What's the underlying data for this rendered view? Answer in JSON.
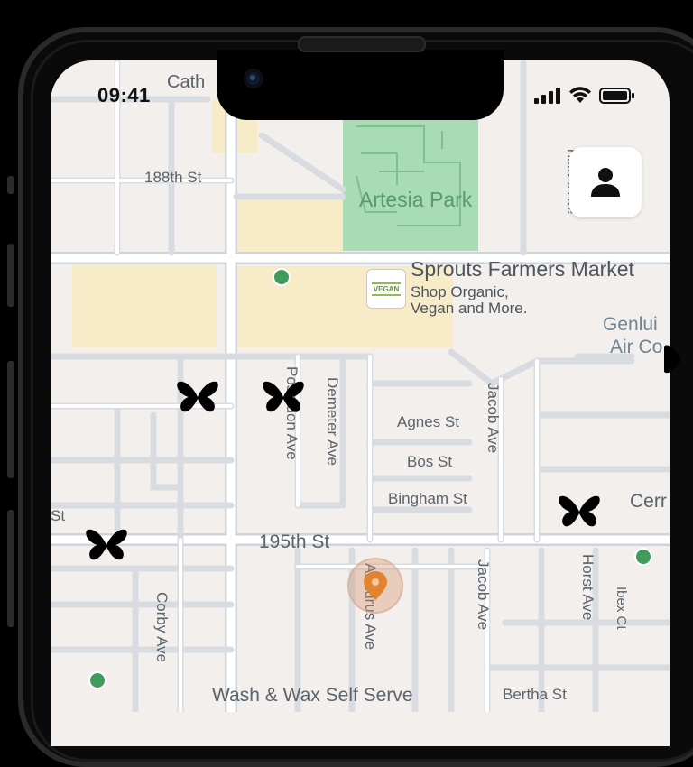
{
  "status_bar": {
    "time": "09:41"
  },
  "map": {
    "streets": {
      "cath": "Cath",
      "st_188th": "188th St",
      "agnes": "Agnes St",
      "bos": "Bos St",
      "bingham": "Bingham St",
      "st_195th": "195th St",
      "poseidon": "Poseidon Ave",
      "demeter": "Demeter Ave",
      "jacob_upper": "Jacob Ave",
      "jacob_lower": "Jacob Ave",
      "horst": "Horst Ave",
      "ibex": "Ibex Ct",
      "corby": "Corby Ave",
      "arcturus": "Arcturus Ave",
      "bertha": "Bertha St",
      "st_left": "St",
      "cerr": "Cerr",
      "right_vertical": "Hoover Ave"
    },
    "places": {
      "park": "Artesia Park",
      "sprouts_title": "Sprouts Farmers Market",
      "sprouts_subtitle": "Shop Organic,\nVegan and More.",
      "sprouts_icon_text": "VEGAN",
      "genlui_line1": "Genlui",
      "genlui_line2": "Air Co",
      "wash": "Wash & Wax Self Serve"
    }
  },
  "colors": {
    "map_background": "#f2efec",
    "road": "#ffffff",
    "road_outline": "#cfd4da",
    "park": "#a8dcb4",
    "commercial": "#f7ecc7",
    "green_marker": "#3f9c5a",
    "location_marker": "#e2832f"
  },
  "icons": {
    "profile": "person-icon",
    "markers": "butterfly-icon"
  }
}
